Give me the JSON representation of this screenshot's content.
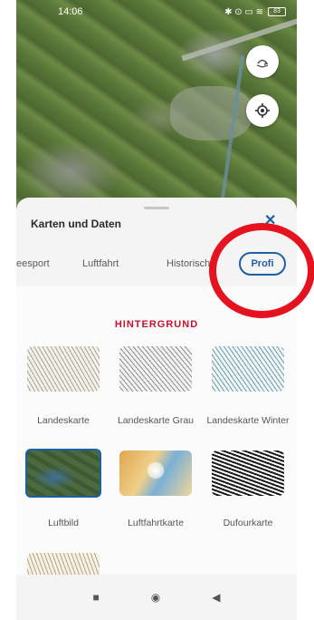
{
  "status": {
    "time": "14:06",
    "icons": "✱ ⊙ ▭ ≋",
    "battery": "83"
  },
  "map": {
    "rotate_icon": "compass-rotate-icon",
    "locate_icon": "gps-locate-icon"
  },
  "sheet": {
    "title": "Karten und Daten",
    "close": "✕",
    "tabs": [
      "eesport",
      "Luftfahrt",
      "Historisch",
      "Profi"
    ],
    "section_heading": "HINTERGRUND",
    "maps": [
      {
        "label": "Landeskarte",
        "selected": false
      },
      {
        "label": "Landeskarte Grau",
        "selected": false
      },
      {
        "label": "Landeskarte Winter",
        "selected": false
      },
      {
        "label": "Luftbild",
        "selected": true
      },
      {
        "label": "Luftfahrtkarte",
        "selected": false
      },
      {
        "label": "Dufourkarte",
        "selected": false
      }
    ]
  },
  "nav": {
    "recents": "■",
    "home": "◉",
    "back": "◀"
  },
  "colors": {
    "accent": "#1f5fa8",
    "heading": "#c8102e",
    "highlight": "#e51220"
  }
}
